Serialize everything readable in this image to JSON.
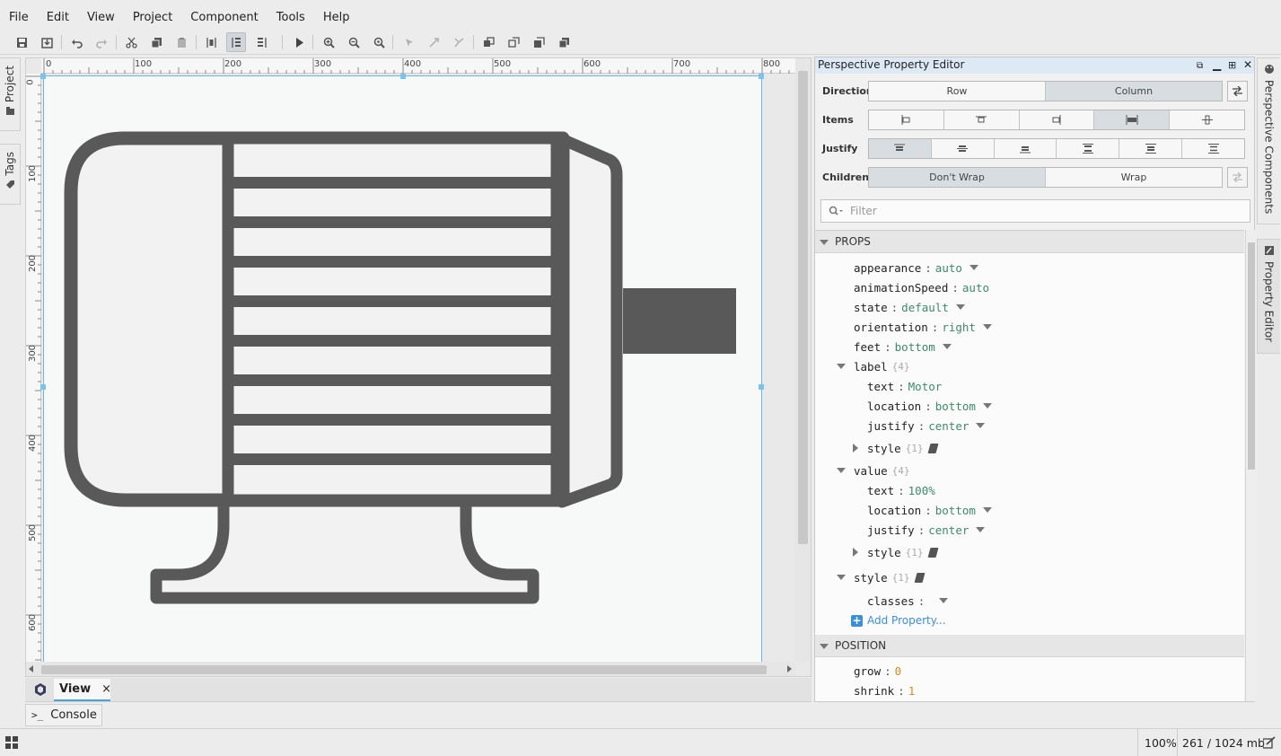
{
  "menu": [
    "File",
    "Edit",
    "View",
    "Project",
    "Component",
    "Tools",
    "Help"
  ],
  "left_tabs": {
    "project": "Project",
    "tags": "Tags"
  },
  "rulers": {
    "h": [
      "0",
      "100",
      "200",
      "300",
      "400",
      "500",
      "600",
      "700",
      "800"
    ],
    "v": [
      "0",
      "100",
      "200",
      "300",
      "400",
      "500",
      "600"
    ]
  },
  "view_tab": {
    "label": "View",
    "close": "×"
  },
  "console": {
    "icon": ">_",
    "label": "Console"
  },
  "status": {
    "zoom": "100%",
    "memory": "261 / 1024 mb"
  },
  "property_editor": {
    "title": "Perspective Property Editor",
    "direction": {
      "label": "Direction",
      "options": [
        "Row",
        "Column"
      ],
      "selected": "Column"
    },
    "items": {
      "label": "Items"
    },
    "justify": {
      "label": "Justify"
    },
    "children": {
      "label": "Children",
      "options": [
        "Don't Wrap",
        "Wrap"
      ],
      "selected": "Don't Wrap"
    },
    "filter_placeholder": "Filter",
    "sections": {
      "props": "PROPS",
      "position": "POSITION"
    },
    "props": {
      "appearance": {
        "key": "appearance",
        "value": "auto"
      },
      "animationSpeed": {
        "key": "animationSpeed",
        "value": "auto"
      },
      "state": {
        "key": "state",
        "value": "default"
      },
      "orientation": {
        "key": "orientation",
        "value": "right"
      },
      "feet": {
        "key": "feet",
        "value": "bottom"
      },
      "label": {
        "key": "label",
        "count": "{4}",
        "text": {
          "key": "text",
          "value": "Motor"
        },
        "location": {
          "key": "location",
          "value": "bottom"
        },
        "justify": {
          "key": "justify",
          "value": "center"
        },
        "style": {
          "key": "style",
          "count": "{1}"
        }
      },
      "value": {
        "key": "value",
        "count": "{4}",
        "text": {
          "key": "text",
          "value": "100%"
        },
        "location": {
          "key": "location",
          "value": "bottom"
        },
        "justify": {
          "key": "justify",
          "value": "center"
        },
        "style": {
          "key": "style",
          "count": "{1}"
        }
      },
      "style": {
        "key": "style",
        "count": "{1}",
        "classes": {
          "key": "classes",
          "value": ""
        }
      },
      "add_property": "Add Property..."
    },
    "position": {
      "grow": {
        "key": "grow",
        "value": "0"
      },
      "shrink": {
        "key": "shrink",
        "value": "1"
      }
    }
  },
  "right_tabs": {
    "components": "Perspective Components",
    "editor": "Property Editor"
  },
  "colors": {
    "motor_stroke": "#595959",
    "motor_fill": "#f2f2f2",
    "selection": "#6fb4e6",
    "value_text": "#3e8a6a",
    "number_text": "#d68a20"
  }
}
